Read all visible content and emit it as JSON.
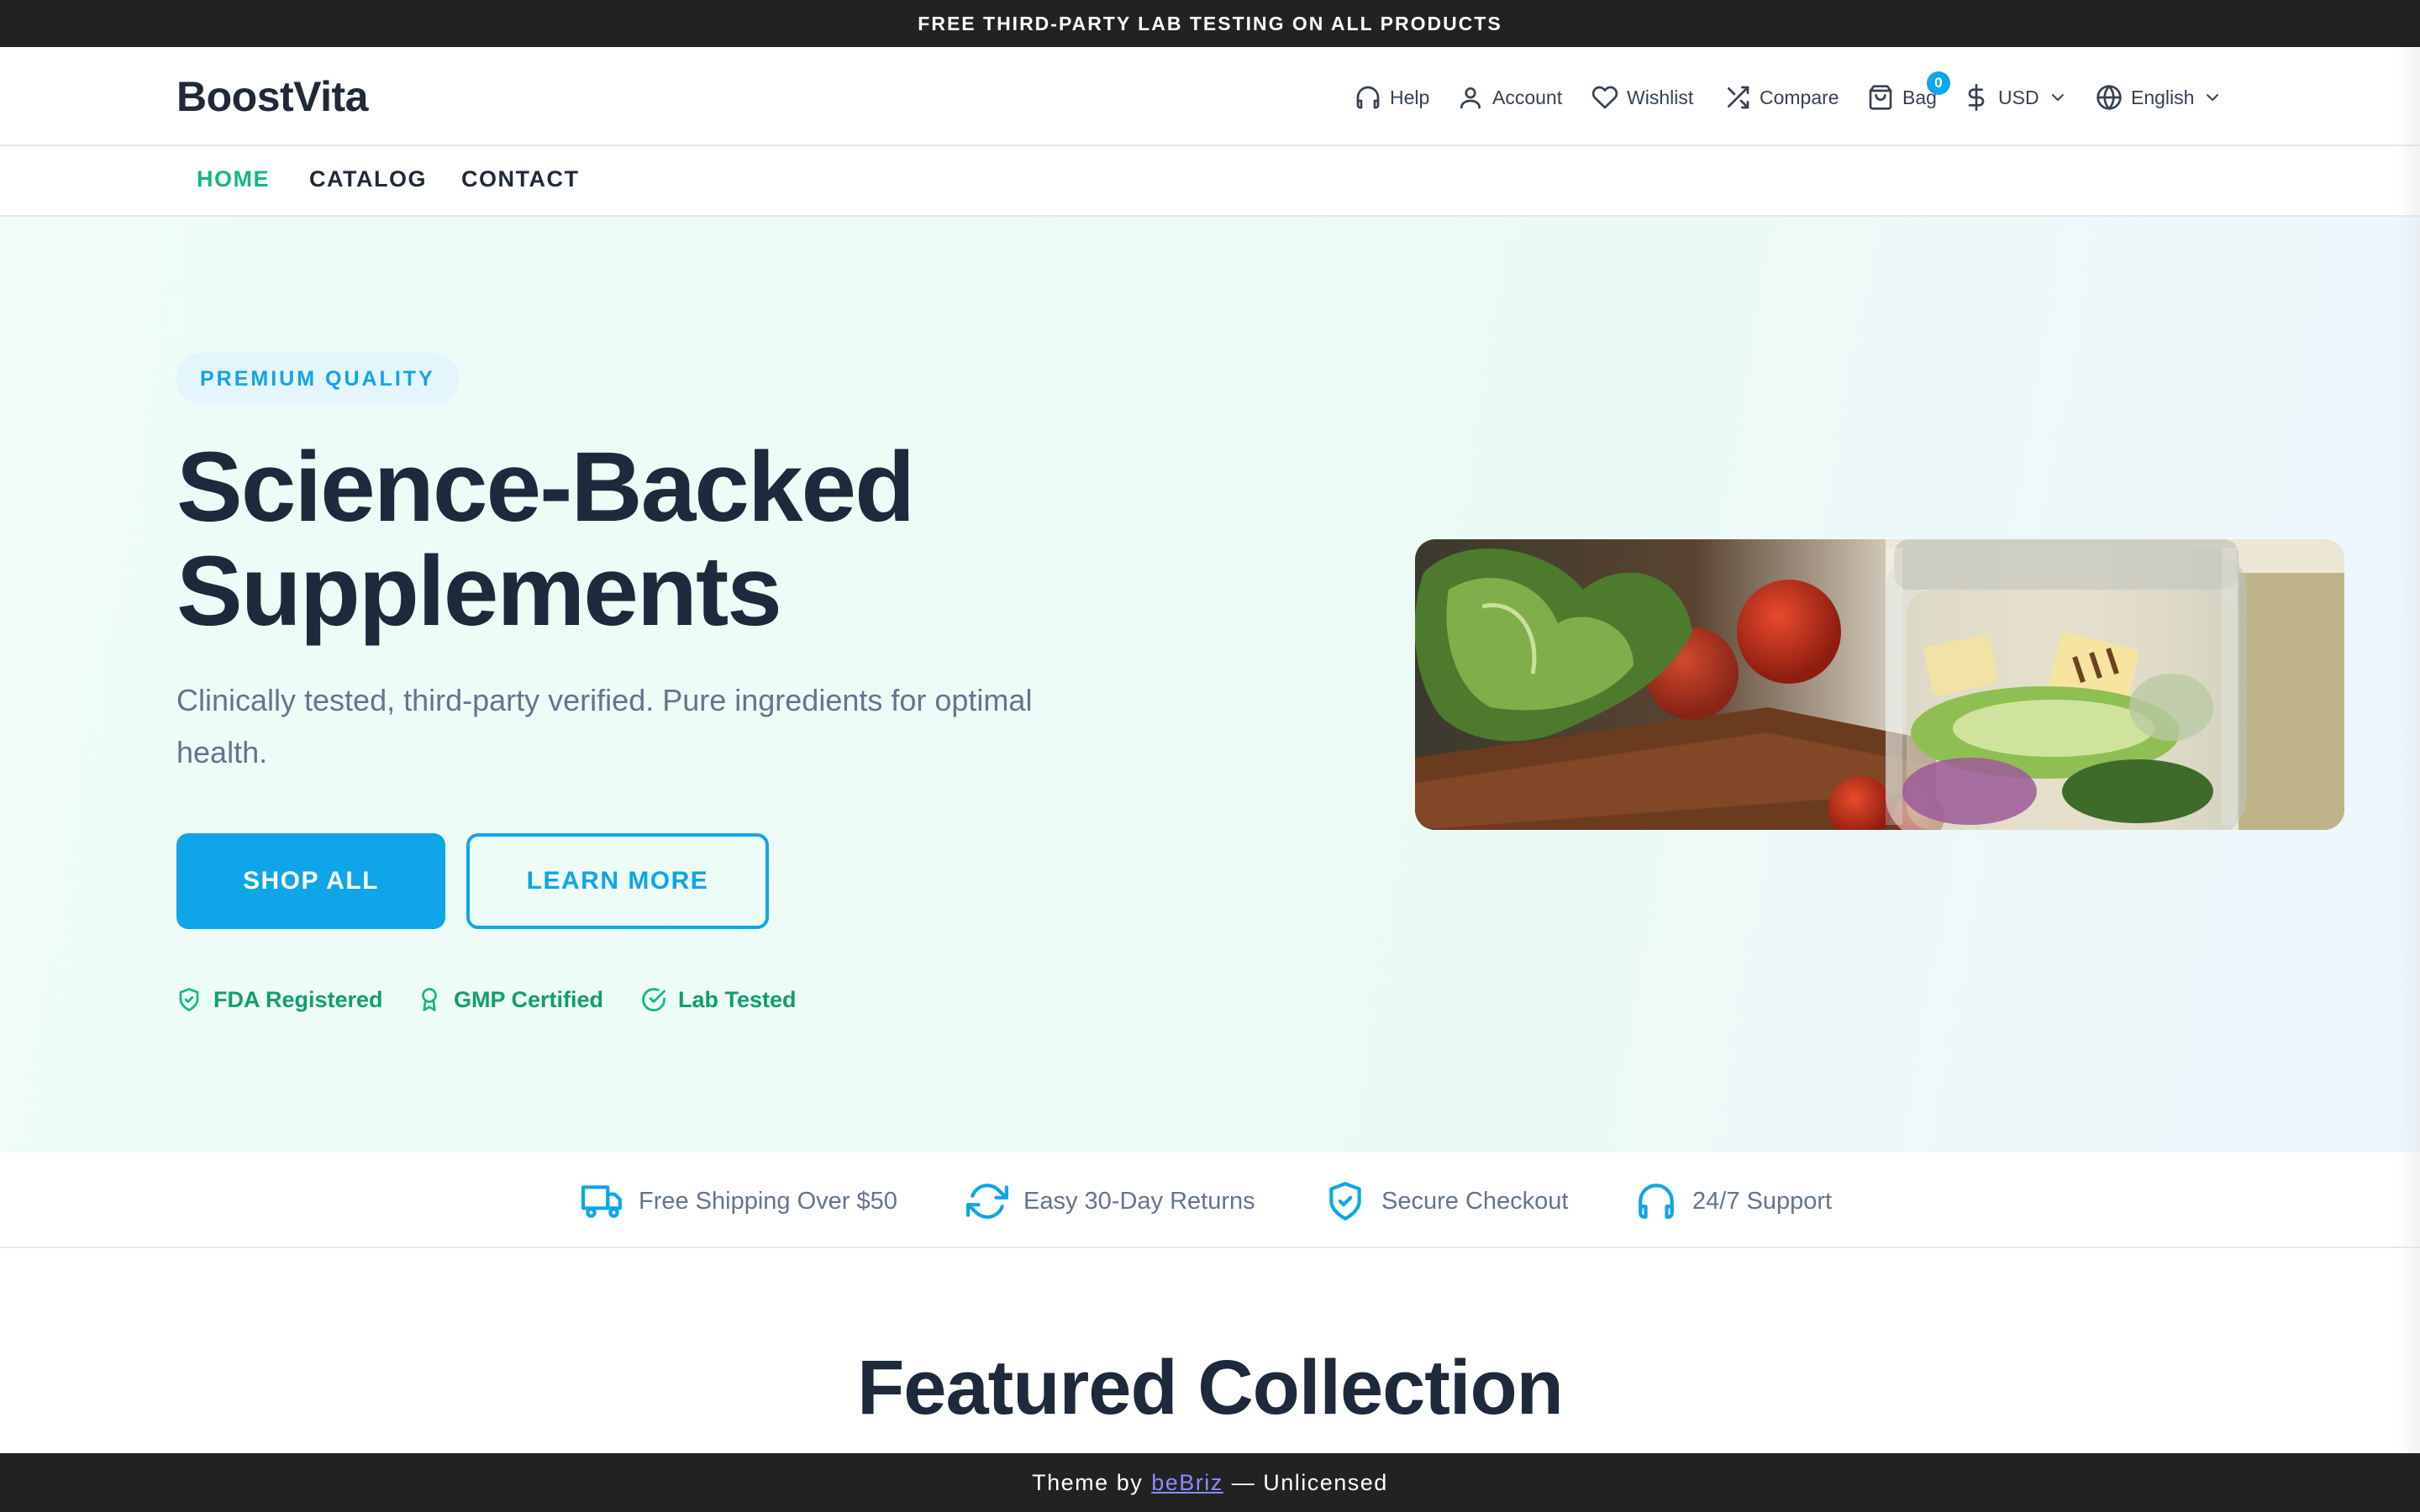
{
  "announcement": "FREE THIRD-PARTY LAB TESTING ON ALL PRODUCTS",
  "header": {
    "logo": "BoostVita",
    "utilities": {
      "help": "Help",
      "account": "Account",
      "wishlist": "Wishlist",
      "compare": "Compare",
      "bag": "Bag",
      "bag_count": "0",
      "currency": "USD",
      "language": "English"
    }
  },
  "nav": {
    "items": [
      {
        "label": "HOME",
        "active": true
      },
      {
        "label": "CATALOG",
        "active": false
      },
      {
        "label": "CONTACT",
        "active": false
      }
    ]
  },
  "hero": {
    "pill": "PREMIUM QUALITY",
    "title_line1": "Science-Backed",
    "title_line2": "Supplements",
    "subtitle": "Clinically tested, third-party verified. Pure ingredients for optimal health.",
    "primary_button": "SHOP ALL",
    "secondary_button": "LEARN MORE",
    "badges": [
      {
        "label": "FDA Registered",
        "icon": "shield-check-icon"
      },
      {
        "label": "GMP Certified",
        "icon": "award-icon"
      },
      {
        "label": "Lab Tested",
        "icon": "check-circle-icon"
      }
    ]
  },
  "features": [
    {
      "label": "Free Shipping Over $50",
      "icon": "truck-icon"
    },
    {
      "label": "Easy 30-Day Returns",
      "icon": "refresh-icon"
    },
    {
      "label": "Secure Checkout",
      "icon": "shield-check-icon"
    },
    {
      "label": "24/7 Support",
      "icon": "headphones-icon"
    }
  ],
  "featured": {
    "title": "Featured Collection"
  },
  "footer": {
    "prefix": "Theme by",
    "link": "beBriz",
    "suffix": "— Unlicensed"
  },
  "colors": {
    "accent": "#0ea5e9",
    "green": "#10b981",
    "dark_bar": "#222222",
    "heading": "#1e293b"
  }
}
